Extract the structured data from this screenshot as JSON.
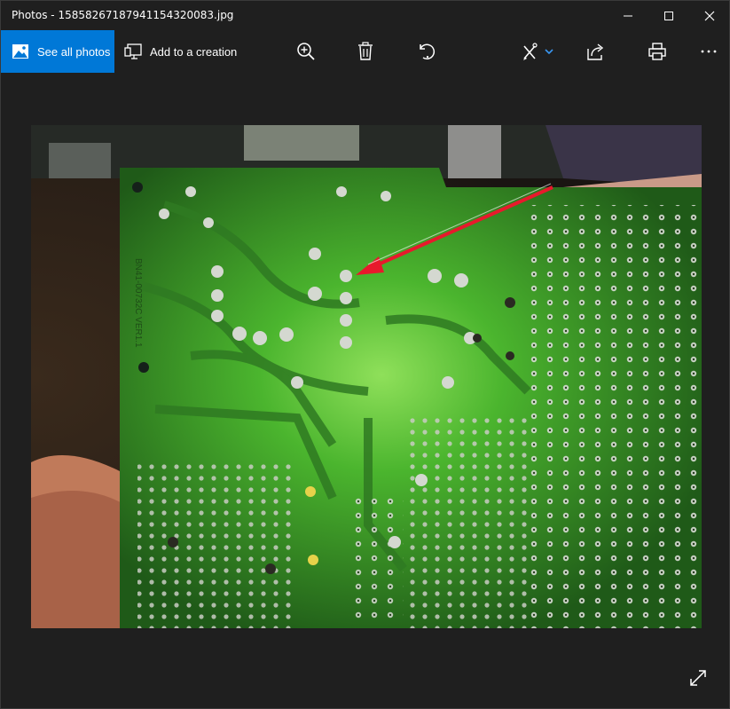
{
  "window": {
    "title": "Photos - 15858267187941154320083.jpg"
  },
  "toolbar": {
    "see_all_photos": "See all photos",
    "add_to_creation": "Add to a creation",
    "icons": [
      "zoom-in-icon",
      "delete-icon",
      "rotate-icon",
      "edit-create-icon",
      "share-icon",
      "print-icon",
      "more-icon"
    ]
  },
  "photo": {
    "board_label": "BN41-00732C VER1.1"
  },
  "colors": {
    "accent": "#0078d7",
    "background": "#1f1f1f",
    "pcb_green": "#3aa02a",
    "arrow_red": "#e8192c"
  }
}
